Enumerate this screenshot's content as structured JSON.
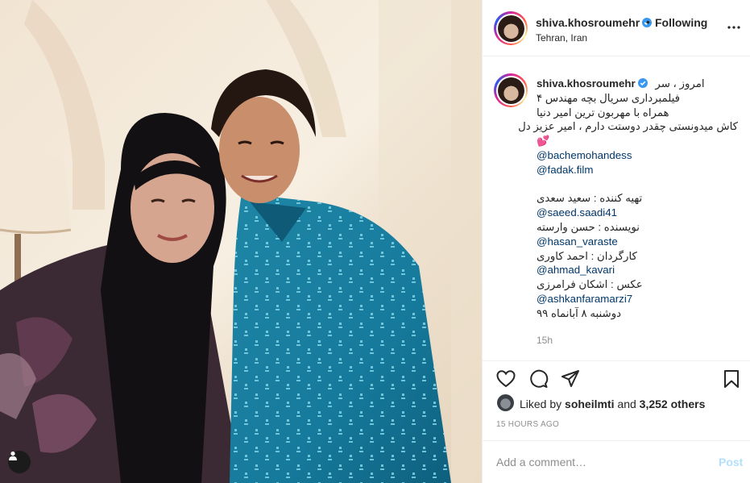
{
  "post": {
    "author": "shiva.khosroumehr",
    "follow_separator": "•",
    "follow_state": "Following",
    "location": "Tehran, Iran"
  },
  "caption": {
    "lines": [
      "امروز ، سر",
      "فیلمبرداری سریال بچه مهندس ۴",
      "همراه با مهربون ترین امیر دنیا",
      "کاش میدونستی چقدر دوستت دارم ، امیر عزیز دل",
      "💕",
      "@bachemohandess",
      "@fadak.film",
      "تهیه کننده : سعید سعدی",
      "@saeed.saadi41",
      "نویسنده : حسن وارسته",
      "@hasan_varaste",
      "کارگردان : احمد کاوری",
      "@ahmad_kavari",
      "عکس : اشکان فرامرزی",
      "@ashkanfaramarzi7",
      "دوشنبه ۸ آبانماه ۹۹"
    ],
    "age": "15h"
  },
  "likes": {
    "prefix": "Liked by",
    "user": "soheilmti",
    "middle": "and",
    "count_text": "3,252 others"
  },
  "posted_ago": "15 HOURS AGO",
  "comment": {
    "placeholder": "Add a comment…",
    "post_label": "Post"
  },
  "icons": {
    "verified": "verified-badge-icon",
    "more": "more-options-icon",
    "like": "heart-icon",
    "comment": "comment-icon",
    "share": "share-icon",
    "save": "bookmark-icon",
    "user_tag": "user-tag-icon"
  },
  "colors": {
    "verified_blue": "#3897f0",
    "mention": "#00376b",
    "muted": "#8e8e8e",
    "post_disabled": "#b2dffc"
  }
}
